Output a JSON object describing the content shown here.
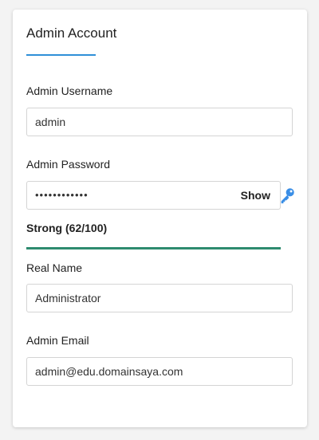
{
  "section": {
    "title": "Admin Account",
    "accent_color": "#2f8fd8"
  },
  "username": {
    "label": "Admin Username",
    "value": "admin"
  },
  "password": {
    "label": "Admin Password",
    "masked_value": "••••••••••••",
    "show_label": "Show",
    "key_icon": "key-icon",
    "strength_text": "Strong (62/100)",
    "strength_fraction": 1.0,
    "strength_color": "#2e8b6f"
  },
  "real_name": {
    "label": "Real Name",
    "value": "Administrator"
  },
  "email": {
    "label": "Admin Email",
    "value": "admin@edu.domainsaya.com"
  }
}
